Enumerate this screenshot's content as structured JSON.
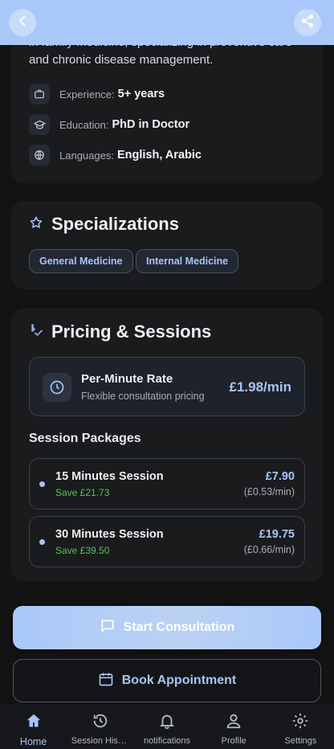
{
  "header": {
    "back_icon": "chevron-left-icon",
    "share_icon": "share-icon",
    "bar_color": "#a9c8f9"
  },
  "about": {
    "text_line1": "in family medicine, specializing in preventive care",
    "text_line2": "and chronic disease management.",
    "rows": [
      {
        "icon": "briefcase-icon",
        "key": "Experience:",
        "value": "5+ years"
      },
      {
        "icon": "graduation-cap-icon",
        "key": "Education:",
        "value": "PhD in Doctor"
      },
      {
        "icon": "globe-icon",
        "key": "Languages:",
        "value": "English, Arabic"
      }
    ]
  },
  "specializations": {
    "title": "Specializations",
    "icon": "star-outline-icon",
    "chips": [
      "General Medicine",
      "Internal Medicine"
    ]
  },
  "pricing": {
    "title": "Pricing & Sessions",
    "icon": "price-check-icon",
    "rate": {
      "icon": "clock-icon",
      "title": "Per-Minute Rate",
      "subtitle": "Flexible consultation pricing",
      "price": "£1.98/min"
    },
    "packages_title": "Session Packages",
    "packages": [
      {
        "name": "15 Minutes Session",
        "save": "Save £21.73",
        "price": "£7.90",
        "per_min": "(£0.53/min)"
      },
      {
        "name": "30 Minutes Session",
        "save": "Save £39.50",
        "price": "£19.75",
        "per_min": "(£0.66/min)"
      }
    ]
  },
  "actions": {
    "start_label": "Start Consultation",
    "start_icon": "chat-icon",
    "book_label": "Book Appointment",
    "book_icon": "calendar-icon"
  },
  "nav": {
    "items": [
      {
        "label": "Home",
        "icon": "home-icon",
        "active": true
      },
      {
        "label": "Session History",
        "icon": "history-icon",
        "active": false
      },
      {
        "label": "notifications",
        "icon": "bell-icon",
        "active": false
      },
      {
        "label": "Profile",
        "icon": "person-icon",
        "active": false
      },
      {
        "label": "Settings",
        "icon": "gear-icon",
        "active": false
      }
    ]
  },
  "colors": {
    "accent": "#a8c4f5",
    "save_green": "#5cbf5c",
    "background": "#131313"
  }
}
